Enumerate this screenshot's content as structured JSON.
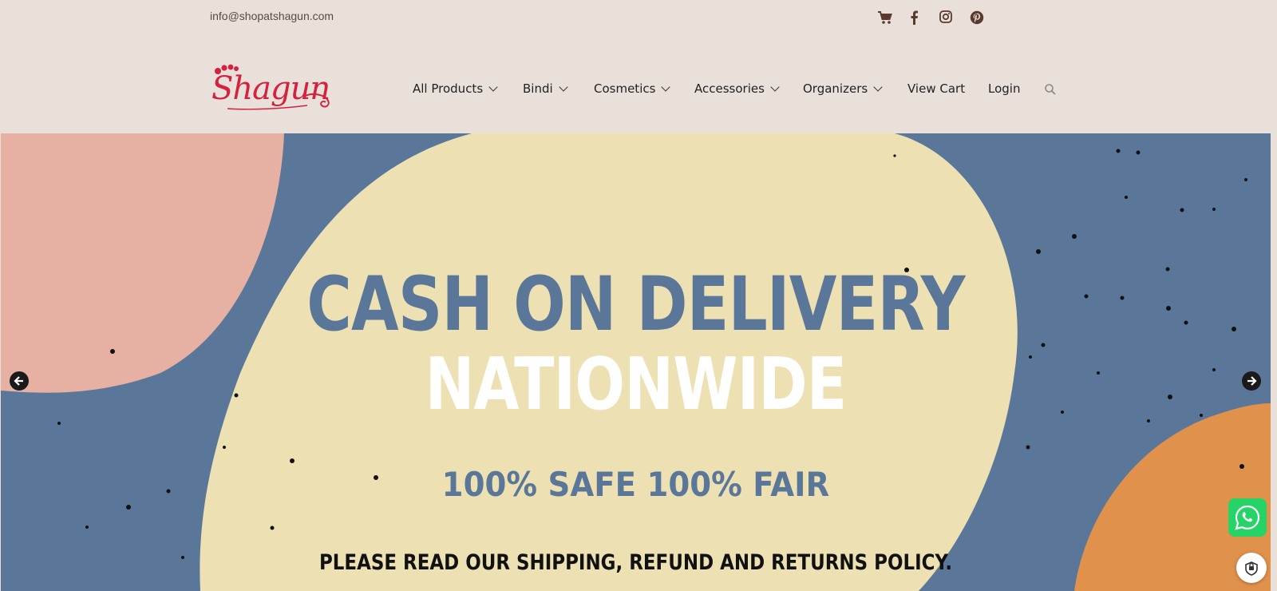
{
  "topbar": {
    "email": "info@shopatshagun.com",
    "social": [
      {
        "name": "cart-icon"
      },
      {
        "name": "facebook-icon"
      },
      {
        "name": "instagram-icon"
      },
      {
        "name": "pinterest-icon"
      }
    ]
  },
  "header": {
    "logo_text": "Shagun",
    "nav": [
      {
        "label": "All Products",
        "dropdown": true
      },
      {
        "label": "Bindi",
        "dropdown": true
      },
      {
        "label": "Cosmetics",
        "dropdown": true
      },
      {
        "label": "Accessories",
        "dropdown": true
      },
      {
        "label": "Organizers",
        "dropdown": true
      },
      {
        "label": "View Cart",
        "dropdown": false
      },
      {
        "label": "Login",
        "dropdown": false
      }
    ],
    "search_icon": "search-icon"
  },
  "banner": {
    "line1": "CASH ON DELIVERY",
    "line2": "NATIONWIDE",
    "line3": "100% SAFE 100% FAIR",
    "line4": "PLEASE READ OUR SHIPPING, REFUND AND RETURNS POLICY.",
    "colors": {
      "background": "#5a7799",
      "blob": "#ede0b3",
      "pink": "#e6b0a2",
      "orange": "#e0914c"
    }
  },
  "widgets": {
    "whatsapp_icon": "whatsapp-icon",
    "badge_icon": "shield-badge-icon"
  },
  "colors": {
    "page_bg": "#e9e0da",
    "brand": "#d4213d",
    "social": "#5a3a2e"
  }
}
